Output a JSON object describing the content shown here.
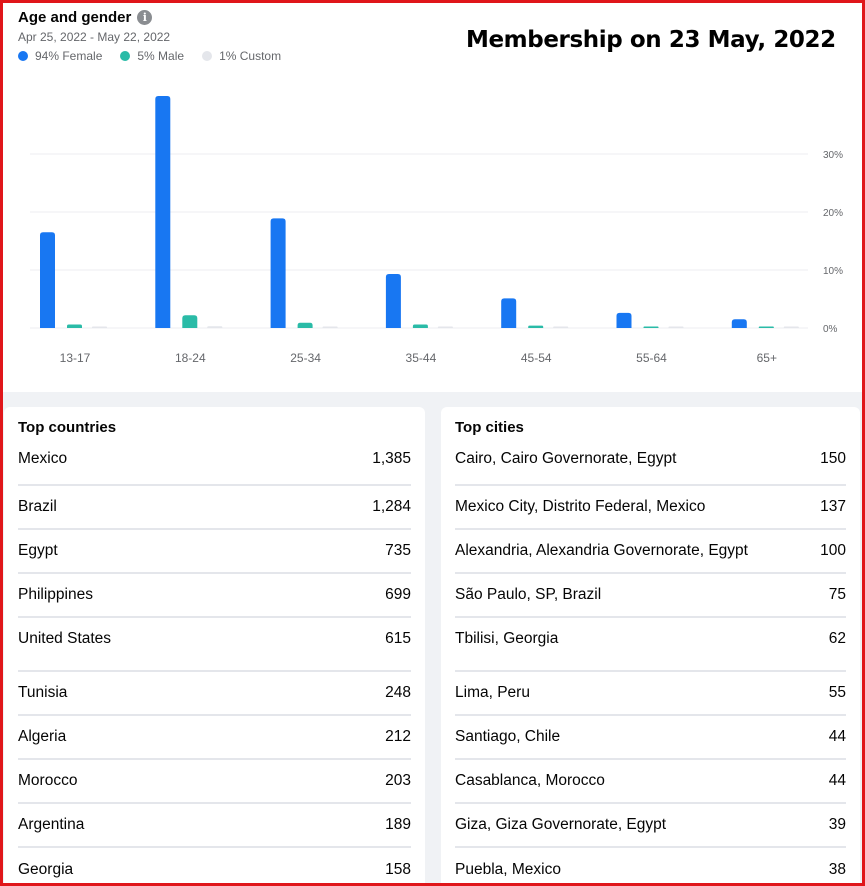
{
  "header": {
    "title": "Age and gender",
    "date_range": "Apr 25, 2022 - May 22, 2022",
    "banner": "Membership on 23 May, 2022",
    "info_glyph": "i"
  },
  "legend": [
    {
      "label": "94% Female",
      "color": "#1877f2"
    },
    {
      "label": "5% Male",
      "color": "#2abba7"
    },
    {
      "label": "1% Custom",
      "color": "#e4e6eb"
    }
  ],
  "chart_data": {
    "type": "bar",
    "categories": [
      "13-17",
      "18-24",
      "25-34",
      "35-44",
      "45-54",
      "55-64",
      "65+"
    ],
    "series": [
      {
        "name": "94% Female",
        "color": "#1877f2",
        "values": [
          16.5,
          40,
          18.9,
          9.3,
          5.1,
          2.6,
          1.5
        ]
      },
      {
        "name": "5% Male",
        "color": "#2abba7",
        "values": [
          0.6,
          2.2,
          0.9,
          0.6,
          0.4,
          0.2,
          0.2
        ]
      },
      {
        "name": "1% Custom",
        "color": "#e4e6eb",
        "values": [
          0.15,
          0.3,
          0.15,
          0.1,
          0.05,
          0.05,
          0.05
        ]
      }
    ],
    "yticks": [
      "0%",
      "10%",
      "20%",
      "30%"
    ],
    "ylim": [
      0,
      40
    ],
    "grid": true,
    "legend_position": "top-left"
  },
  "top_countries": {
    "title": "Top countries",
    "rows": [
      {
        "name": "Mexico",
        "count": "1,385"
      },
      {
        "name": "Brazil",
        "count": "1,284"
      },
      {
        "name": "Egypt",
        "count": "735"
      },
      {
        "name": "Philippines",
        "count": "699"
      },
      {
        "name": "United States",
        "count": "615"
      },
      {
        "name": "Tunisia",
        "count": "248"
      },
      {
        "name": "Algeria",
        "count": "212"
      },
      {
        "name": "Morocco",
        "count": "203"
      },
      {
        "name": "Argentina",
        "count": "189"
      },
      {
        "name": "Georgia",
        "count": "158"
      }
    ]
  },
  "top_cities": {
    "title": "Top cities",
    "rows": [
      {
        "name": "Cairo, Cairo Governorate, Egypt",
        "count": "150"
      },
      {
        "name": "Mexico City, Distrito Federal, Mexico",
        "count": "137"
      },
      {
        "name": "Alexandria, Alexandria Governorate, Egypt",
        "count": "100"
      },
      {
        "name": "São Paulo, SP, Brazil",
        "count": "75"
      },
      {
        "name": "Tbilisi, Georgia",
        "count": "62"
      },
      {
        "name": "Lima, Peru",
        "count": "55"
      },
      {
        "name": "Santiago, Chile",
        "count": "44"
      },
      {
        "name": "Casablanca, Morocco",
        "count": "44"
      },
      {
        "name": "Giza, Giza Governorate, Egypt",
        "count": "39"
      },
      {
        "name": "Puebla, Mexico",
        "count": "38"
      }
    ]
  }
}
